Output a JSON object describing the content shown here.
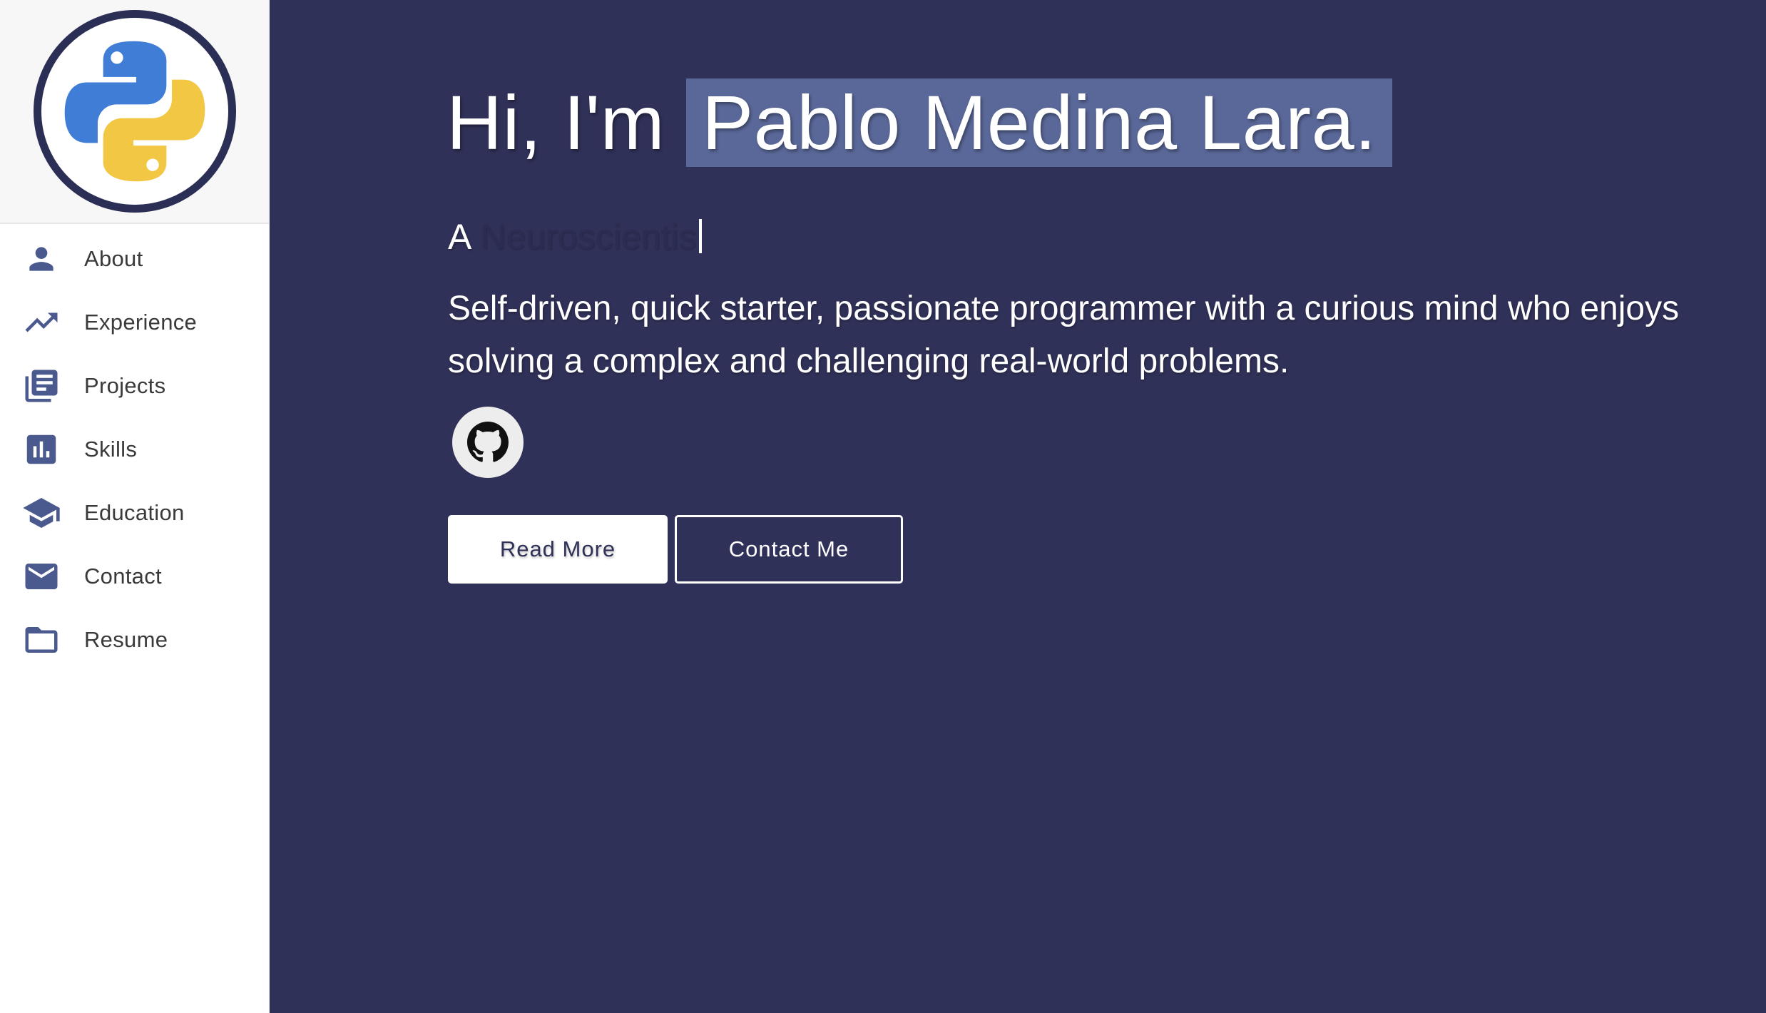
{
  "sidebar": {
    "logo": {
      "icon": "python-logo-icon"
    },
    "items": [
      {
        "label": "About",
        "icon": "person-icon"
      },
      {
        "label": "Experience",
        "icon": "trending-up-icon"
      },
      {
        "label": "Projects",
        "icon": "library-books-icon"
      },
      {
        "label": "Skills",
        "icon": "bar-chart-icon"
      },
      {
        "label": "Education",
        "icon": "graduation-cap-icon"
      },
      {
        "label": "Contact",
        "icon": "mail-icon"
      },
      {
        "label": "Resume",
        "icon": "folder-icon"
      }
    ]
  },
  "hero": {
    "greeting_prefix": "Hi, I'm",
    "name": "Pablo Medina Lara.",
    "typed_prefix": "A",
    "typed_role": "Neuroscientis",
    "description": "Self-driven, quick starter, passionate programmer with a curious mind who enjoys solving a complex and challenging real-world problems.",
    "github_icon": "github-icon",
    "read_more_label": "Read More",
    "contact_label": "Contact Me"
  },
  "colors": {
    "main_bg": "#303158",
    "name_highlight": "#5a6899",
    "icon_color": "#4a5a8e",
    "python_blue": "#3f7dd6",
    "python_yellow": "#f2c744"
  }
}
